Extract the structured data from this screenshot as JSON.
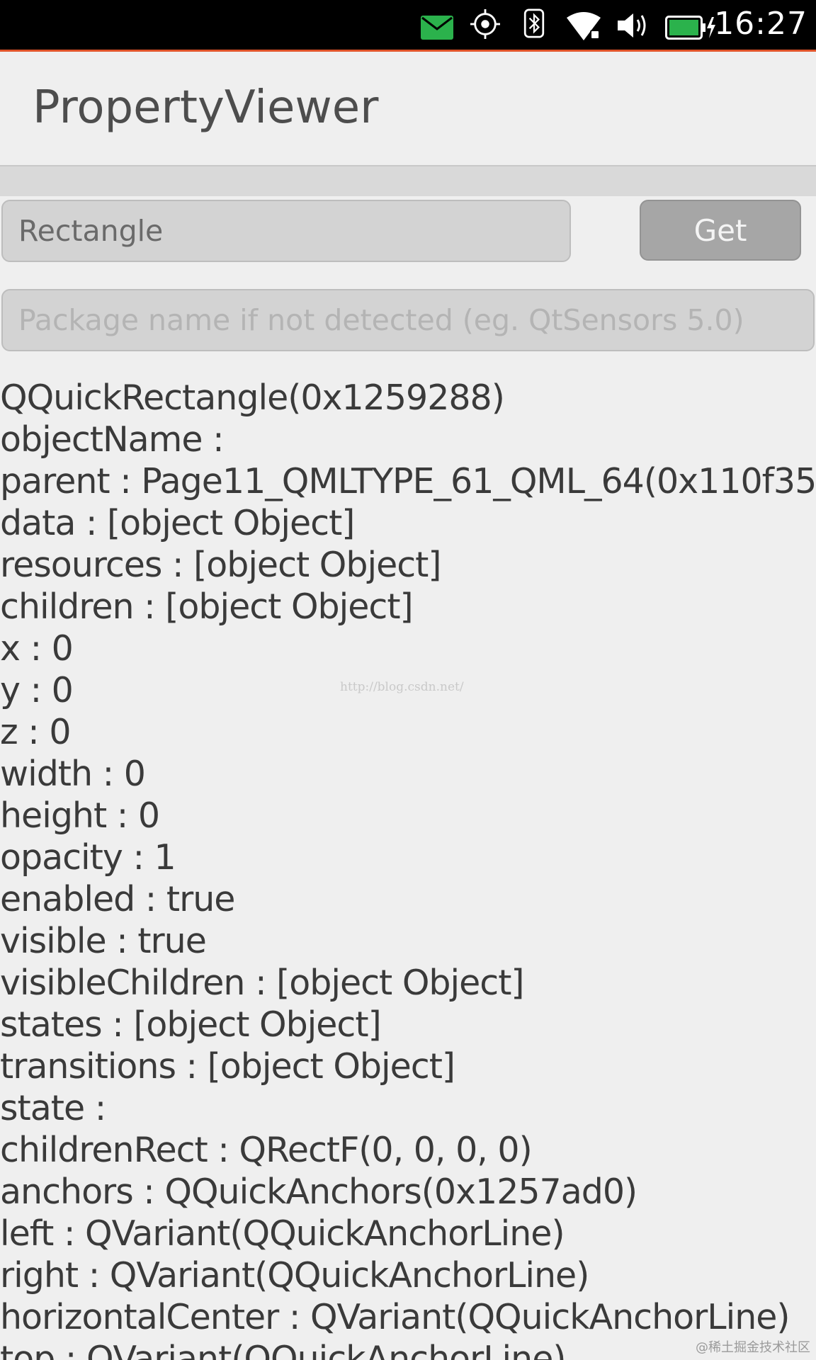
{
  "status_bar": {
    "time": "16:27",
    "icons": [
      "mail-icon",
      "location-icon",
      "bluetooth-icon",
      "wifi-icon",
      "volume-icon",
      "battery-charging-icon"
    ],
    "mail_color": "#2bb24c",
    "battery_color": "#2bb24c"
  },
  "header": {
    "title": "PropertyViewer"
  },
  "form": {
    "type_value": "Rectangle",
    "get_label": "Get",
    "package_placeholder": "Package name if not detected (eg. QtSensors 5.0)"
  },
  "properties": [
    "QQuickRectangle(0x1259288)",
    "objectName :",
    "parent : Page11_QMLTYPE_61_QML_64(0x110f35",
    "data : [object Object]",
    "resources : [object Object]",
    "children : [object Object]",
    "x : 0",
    "y : 0",
    "z : 0",
    "width : 0",
    "height : 0",
    "opacity : 1",
    "enabled : true",
    "visible : true",
    "visibleChildren : [object Object]",
    "states : [object Object]",
    "transitions : [object Object]",
    "state :",
    "childrenRect : QRectF(0, 0, 0, 0)",
    "anchors : QQuickAnchors(0x1257ad0)",
    "left : QVariant(QQuickAnchorLine)",
    "right : QVariant(QQuickAnchorLine)",
    "horizontalCenter : QVariant(QQuickAnchorLine)",
    "top : QVariant(QQuickAnchorLine)"
  ],
  "watermark": "http://blog.csdn.net/",
  "corner_watermark": "@稀土掘金技术社区"
}
